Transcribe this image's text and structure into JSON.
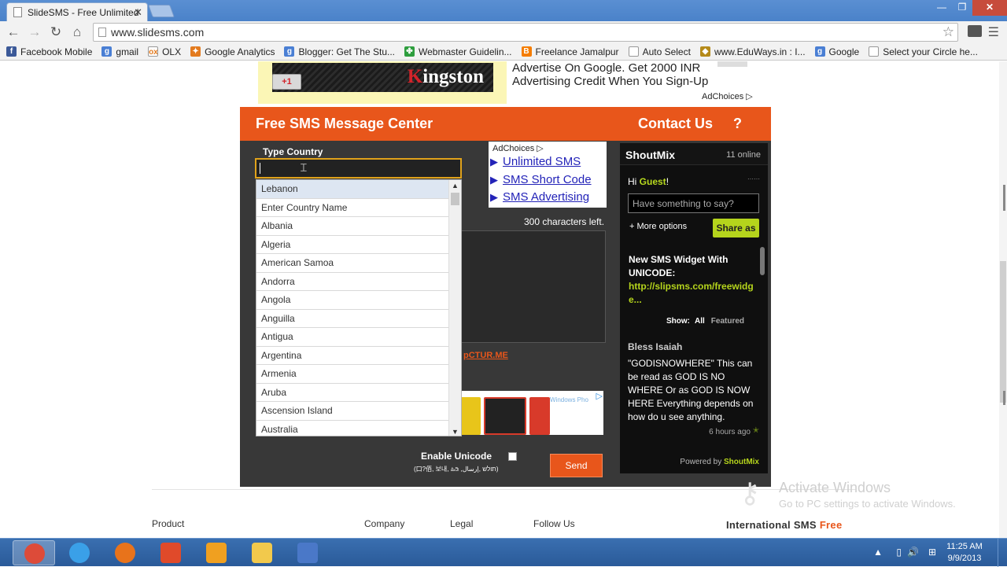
{
  "browser": {
    "tab_title": "SlideSMS - Free Unlimited",
    "tab_close": "✕",
    "url": "www.slidesms.com",
    "window_controls": {
      "minimize": "—",
      "restore": "❐",
      "close": "✕"
    },
    "bookmarks": [
      {
        "label": "Facebook Mobile",
        "icon": "facebook-icon",
        "color": "#3b5998",
        "glyph": "f"
      },
      {
        "label": "gmail",
        "icon": "google-icon",
        "color": "#4a7fd4",
        "glyph": "g"
      },
      {
        "label": "OLX",
        "icon": "olx-icon",
        "color": "#ffffff",
        "glyph": "ox"
      },
      {
        "label": "Google Analytics",
        "icon": "analytics-icon",
        "color": "#e37b1f",
        "glyph": "✦"
      },
      {
        "label": "Blogger: Get The Stu...",
        "icon": "google-icon",
        "color": "#4a7fd4",
        "glyph": "g"
      },
      {
        "label": "Webmaster Guidelin...",
        "icon": "webmaster-icon",
        "color": "#2e9e3e",
        "glyph": "✤"
      },
      {
        "label": "Freelance Jamalpur",
        "icon": "blogger-icon",
        "color": "#f57d00",
        "glyph": "B"
      },
      {
        "label": "Auto Select",
        "icon": "page-icon",
        "color": "#ffffff",
        "glyph": ""
      },
      {
        "label": "www.EduWays.in : I...",
        "icon": "eduways-icon",
        "color": "#b58a1a",
        "glyph": "◆"
      },
      {
        "label": "Google",
        "icon": "google-icon",
        "color": "#4a7fd4",
        "glyph": "g"
      },
      {
        "label": "Select your Circle he...",
        "icon": "page-icon",
        "color": "#ffffff",
        "glyph": ""
      }
    ]
  },
  "ad_top": {
    "brand": "ingston",
    "brand_initial": "K",
    "gplus": "+1",
    "line1": "Advertise On Google. Get 2000 INR",
    "line2": "Advertising Credit When You Sign-Up",
    "adchoices": "AdChoices ▷"
  },
  "sms": {
    "title": "Free SMS Message Center",
    "contact": "Contact Us",
    "help": "?",
    "type_country_label": "Type Country",
    "countries": [
      "Lebanon",
      "Enter Country Name",
      "Albania",
      "Algeria",
      "American Samoa",
      "Andorra",
      "Angola",
      "Anguilla",
      "Antigua",
      "Argentina",
      "Armenia",
      "Aruba",
      "Ascension Island",
      "Australia"
    ],
    "selected_country": "Lebanon",
    "ad_links": {
      "adchoices": "AdChoices ▷",
      "links": [
        "Unlimited SMS",
        "SMS Short Code",
        "SMS Advertising"
      ]
    },
    "chars_left": "300 characters left.",
    "pctur": "pCTUR.ME",
    "phone_ad_text": "Windows Pho",
    "enable_unicode": "Enable Unicode",
    "unicode_sample": "(口?佰, 보내, ಹಿಡಿ ,תולש ,إرسال)",
    "send": "Send"
  },
  "shoutmix": {
    "title": "ShoutMix",
    "online": "11 online",
    "hi": "Hi ",
    "guest": "Guest",
    "exclaim": "!",
    "placeholder": "Have something to say?",
    "more_options": "+ More options",
    "share": "Share as",
    "news_title": "New SMS Widget With UNICODE:",
    "news_url": "http://slipsms.com/freewidge...",
    "show_label": "Show:",
    "show_all": "All",
    "show_featured": "Featured",
    "author": "Bless Isaiah",
    "message": "\"GODISNOWHERE\" This can be read as GOD IS NO WHERE Or as GOD IS NOW HERE Everything depends on how do u see anything.",
    "time": "6 hours ago",
    "powered_by": "Powered by ",
    "powered_name": "ShoutMix"
  },
  "footer": {
    "product": "Product",
    "company": "Company",
    "legal": "Legal",
    "follow": "Follow Us",
    "intl": "International SMS ",
    "intl_free": "Free"
  },
  "watermark": {
    "line1": "Activate Windows",
    "line2": "Go to PC settings to activate Windows."
  },
  "taskbar": {
    "apps": [
      {
        "name": "chrome-icon",
        "color": "#dd4b39"
      },
      {
        "name": "internet-explorer-icon",
        "color": "#3aa0e8"
      },
      {
        "name": "firefox-icon",
        "color": "#e8731b"
      },
      {
        "name": "power-icon",
        "color": "#e04a2a"
      },
      {
        "name": "micromax-icon",
        "color": "#f0a020"
      },
      {
        "name": "file-explorer-icon",
        "color": "#f2c94c"
      },
      {
        "name": "movie-maker-icon",
        "color": "#4a78c8"
      }
    ],
    "time": "11:25 AM",
    "date": "9/9/2013"
  }
}
